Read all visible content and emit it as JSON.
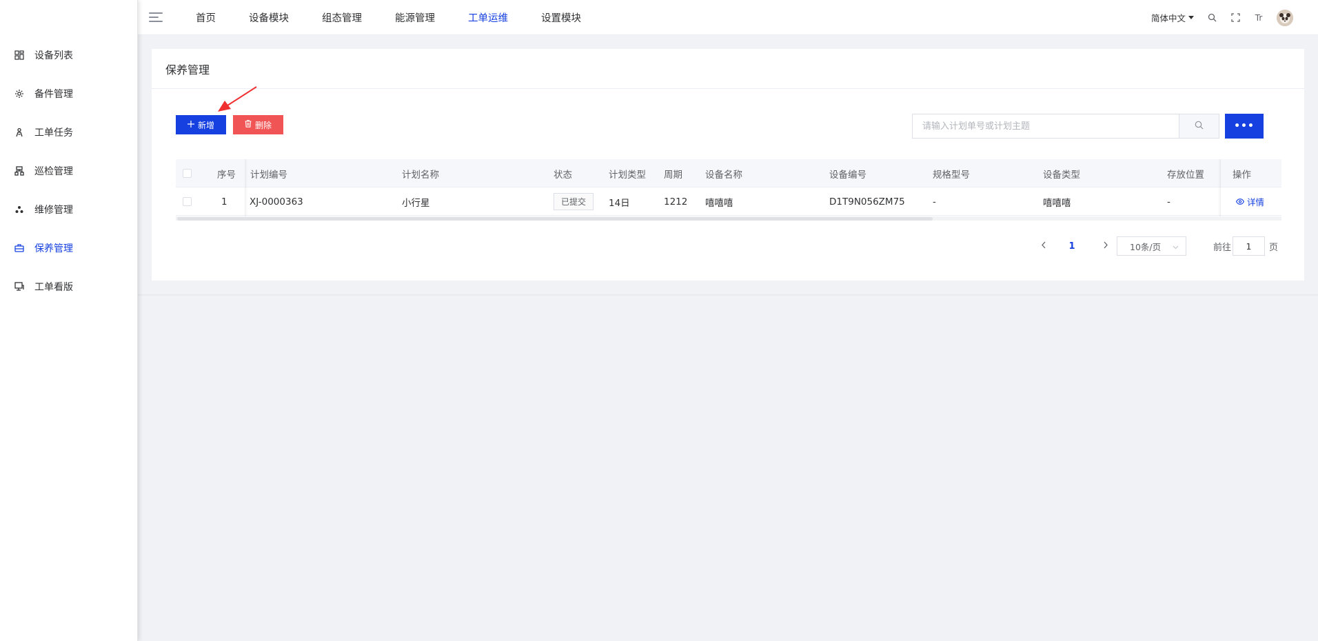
{
  "sidebar": {
    "items": [
      {
        "label": "设备列表",
        "icon": "grid-icon"
      },
      {
        "label": "备件管理",
        "icon": "gear-icon"
      },
      {
        "label": "工单任务",
        "icon": "person-icon"
      },
      {
        "label": "巡检管理",
        "icon": "org-chart-icon"
      },
      {
        "label": "维修管理",
        "icon": "cluster-icon"
      },
      {
        "label": "保养管理",
        "icon": "toolbox-icon",
        "active": true
      },
      {
        "label": "工单看版",
        "icon": "monitor-icon"
      }
    ]
  },
  "topbar": {
    "nav": [
      "首页",
      "设备模块",
      "组态管理",
      "能源管理",
      "工单运维",
      "设置模块"
    ],
    "active_nav": "工单运维",
    "language": "简体中文",
    "font_size_icon_label": "Tr"
  },
  "page": {
    "title": "保养管理",
    "add_label": "新增",
    "delete_label": "删除",
    "search_placeholder": "请输入计划单号或计划主题",
    "more_label": "•••"
  },
  "table": {
    "headers": {
      "index": "序号",
      "plan_no": "计划编号",
      "plan_name": "计划名称",
      "status": "状态",
      "plan_type": "计划类型",
      "cycle": "周期",
      "device_name": "设备名称",
      "device_no": "设备编号",
      "spec": "规格型号",
      "device_type": "设备类型",
      "location": "存放位置",
      "action": "操作"
    },
    "rows": [
      {
        "index": "1",
        "plan_no": "XJ-0000363",
        "plan_name": "小行星",
        "status": "已提交",
        "plan_type": "14日",
        "cycle": "1212",
        "device_name": "嘻嘻嘻",
        "device_no": "D1T9N056ZM75",
        "spec": "-",
        "device_type": "嘻嘻嘻",
        "location": "-",
        "action": "详情"
      }
    ]
  },
  "pagination": {
    "current_page": "1",
    "page_size_label": "10条/页",
    "goto_label": "前往",
    "goto_value": "1",
    "page_unit": "页"
  },
  "colors": {
    "primary": "#1640e0",
    "danger": "#f05454",
    "annotation_arrow": "#f03030"
  }
}
